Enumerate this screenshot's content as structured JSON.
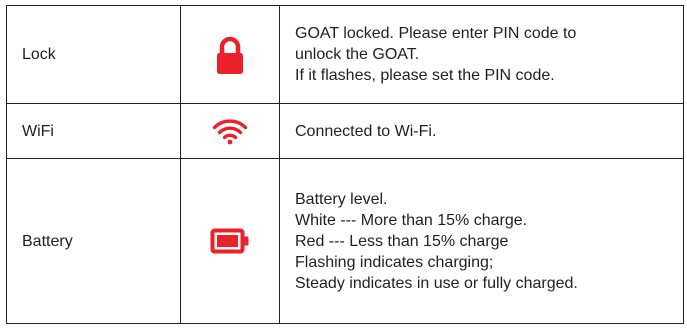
{
  "accent_color": "#e8212a",
  "rows": [
    {
      "name": "Lock",
      "icon": "lock-icon",
      "description": [
        "GOAT locked. Please enter PIN code to",
        "unlock the GOAT.",
        "If it flashes, please set the PIN code."
      ]
    },
    {
      "name": "WiFi",
      "icon": "wifi-icon",
      "description": [
        "Connected to Wi-Fi."
      ]
    },
    {
      "name": "Battery",
      "icon": "battery-icon",
      "description": [
        "Battery level.",
        "White --- More than 15% charge.",
        "Red --- Less than 15% charge",
        "Flashing indicates charging;",
        "Steady indicates in use or fully charged."
      ]
    }
  ]
}
